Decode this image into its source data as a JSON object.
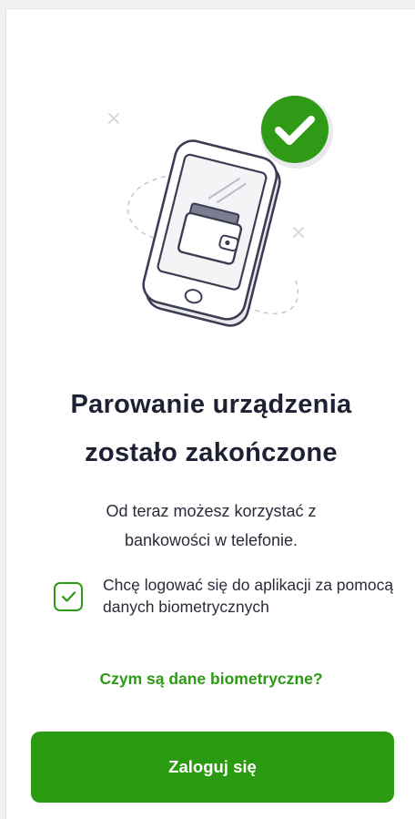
{
  "success": {
    "title_line1": "Parowanie urządzenia",
    "title_line2": "zostało zakończone",
    "subtitle_line1": "Od teraz możesz korzystać z",
    "subtitle_line2": "bankowości w telefonie."
  },
  "biometrics": {
    "checked": true,
    "label": "Chcę logować się do aplikacji za pomocą danych biometrycznych",
    "info_link": "Czym są dane biometryczne?"
  },
  "actions": {
    "login_label": "Zaloguj się"
  },
  "illustration": {
    "icons": [
      "phone-icon",
      "wallet-icon",
      "check-badge-icon",
      "sparkle-x-icon"
    ]
  },
  "colors": {
    "brand_green": "#2a9a10",
    "title_text": "#1e2033",
    "body_text": "#2a2b3a"
  }
}
